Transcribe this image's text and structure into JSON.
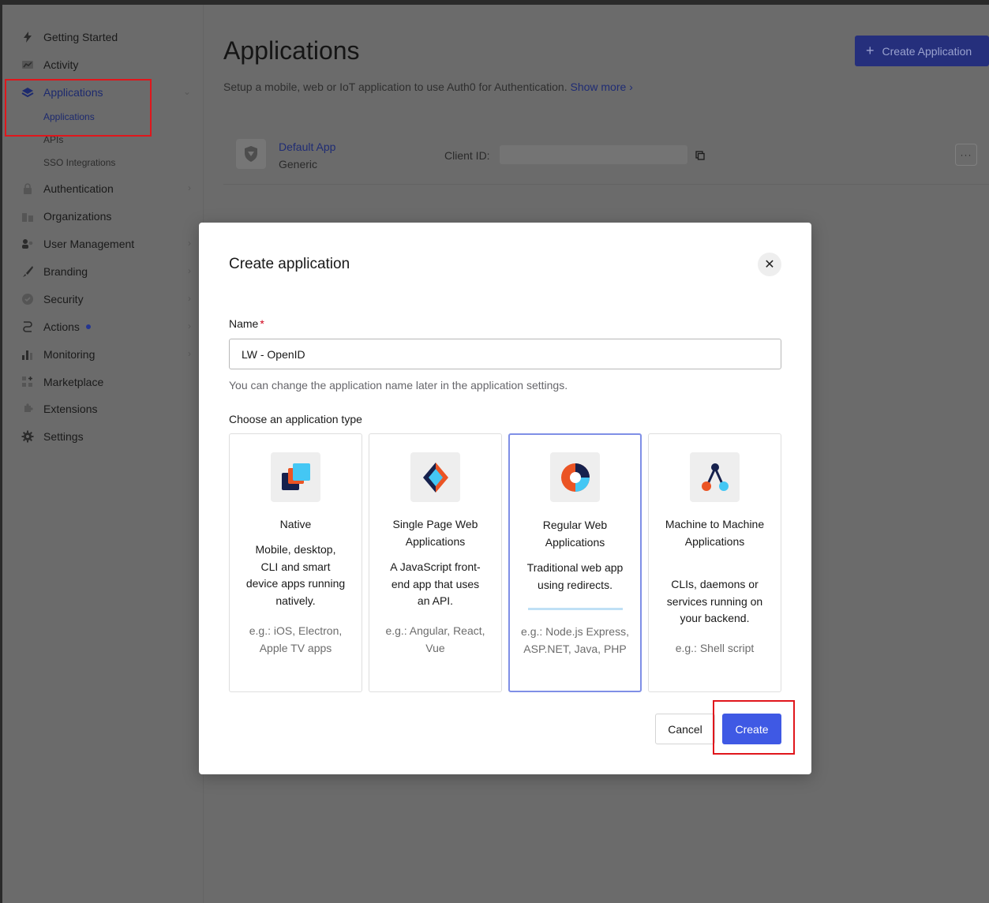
{
  "sidebar": {
    "items": [
      {
        "label": "Getting Started",
        "icon": "bolt-icon"
      },
      {
        "label": "Activity",
        "icon": "activity-chart-icon"
      },
      {
        "label": "Applications",
        "icon": "layers-icon"
      },
      {
        "label": "Authentication",
        "icon": "lock-icon"
      },
      {
        "label": "Organizations",
        "icon": "building-icon"
      },
      {
        "label": "User Management",
        "icon": "users-icon"
      },
      {
        "label": "Branding",
        "icon": "brush-icon"
      },
      {
        "label": "Security",
        "icon": "shield-check-icon"
      },
      {
        "label": "Actions",
        "icon": "flow-icon"
      },
      {
        "label": "Monitoring",
        "icon": "bar-chart-icon"
      },
      {
        "label": "Marketplace",
        "icon": "grid-plus-icon"
      },
      {
        "label": "Extensions",
        "icon": "puzzle-icon"
      },
      {
        "label": "Settings",
        "icon": "gear-icon"
      }
    ],
    "subitems": [
      "Applications",
      "APIs",
      "SSO Integrations"
    ]
  },
  "header": {
    "title": "Applications",
    "subtitle": "Setup a mobile, web or IoT application to use Auth0 for Authentication.",
    "show_more": "Show more",
    "create_button": "Create Application"
  },
  "app_row": {
    "name": "Default App",
    "type": "Generic",
    "client_id_label": "Client ID:",
    "more": "···"
  },
  "modal": {
    "title": "Create application",
    "name_label": "Name",
    "required_mark": "*",
    "name_value": "LW - OpenID",
    "help_text": "You can change the application name later in the application settings.",
    "choose_label": "Choose an application type",
    "types": [
      {
        "title": "Native",
        "desc": "Mobile, desktop, CLI and smart device apps running natively.",
        "examples": "e.g.: iOS, Electron, Apple TV apps"
      },
      {
        "title": "Single Page Web Applications",
        "desc": "A JavaScript front-end app that uses an API.",
        "examples": "e.g.: Angular, React, Vue"
      },
      {
        "title": "Regular Web Applications",
        "desc": "Traditional web app using redirects.",
        "examples": "e.g.: Node.js Express, ASP.NET, Java, PHP",
        "selected": true
      },
      {
        "title": "Machine to Machine Applications",
        "desc": "CLIs, daemons or services running on your backend.",
        "examples": "e.g.: Shell script"
      }
    ],
    "cancel_label": "Cancel",
    "create_label": "Create"
  },
  "colors": {
    "primary": "#3f59e4",
    "selected_border": "#7f8fe6",
    "highlight": "#e0161c"
  }
}
